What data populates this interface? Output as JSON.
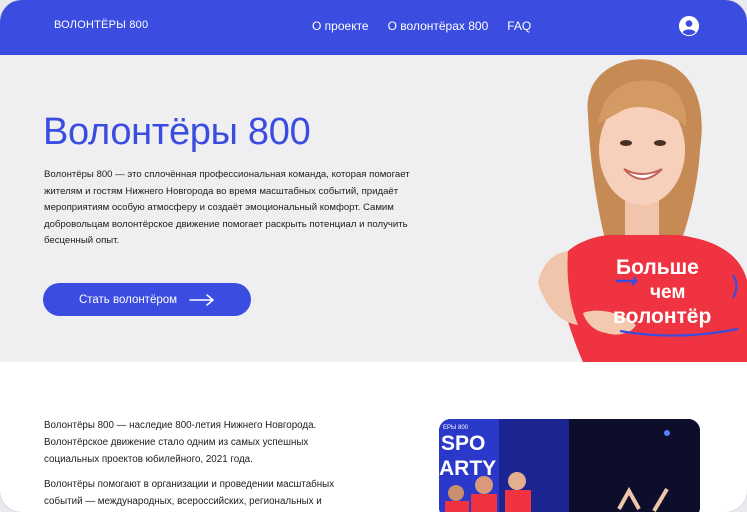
{
  "header": {
    "logo": "ВОЛОНТЁРЫ 800",
    "nav": [
      "О проекте",
      "О волонтёрах 800",
      "FAQ"
    ],
    "user_icon": "user-circle-icon"
  },
  "hero": {
    "title": "Волонтёры 800",
    "text": "Волонтёры 800 — это сплочённая профессиональная команда, которая помогает жителям и гостям Нижнего Новгорода во время масштабных событий, придаёт мероприятиям особую атмосферу и создаёт эмоциональный комфорт. Самим добровольцам волонтёрское движение помогает раскрыть потенциал и получить бесценный опыт.",
    "cta_label": "Стать волонтёром",
    "cta_icon": "arrow-right-icon",
    "shirt_lines": [
      "Больше",
      "чем",
      "волонтёр"
    ],
    "accent": "#3a4de0"
  },
  "about": {
    "paragraphs": [
      "Волонтёры 800 — наследие 800-летия Нижнего Новгорода. Волонтёрское движение стало одним из самых успешных социальных проектов юбилейного, 2021 года.",
      "Волонтёры помогают в организации и проведении масштабных событий — международных, всероссийских, региональных и"
    ],
    "photo_text": [
      "ЕРЫ 800",
      "SPO",
      "ARTY"
    ]
  }
}
